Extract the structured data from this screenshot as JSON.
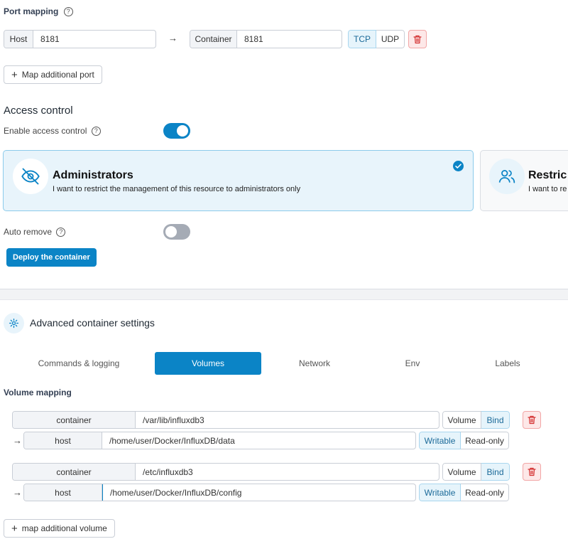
{
  "port_mapping": {
    "title": "Port mapping",
    "help": "?",
    "host_label": "Host",
    "host_value": "8181",
    "arrow": "→",
    "container_label": "Container",
    "container_value": "8181",
    "protocols": [
      "TCP",
      "UDP"
    ],
    "active_protocol": "TCP",
    "add_label": "Map additional port"
  },
  "access_control": {
    "title": "Access control",
    "enable_label": "Enable access control",
    "enabled": true,
    "options": [
      {
        "title": "Administrators",
        "description": "I want to restrict the management of this resource to administrators only",
        "selected": true,
        "icon": "eye-off-icon"
      },
      {
        "title": "Restric",
        "description": "I want to re",
        "selected": false,
        "icon": "users-icon"
      }
    ],
    "auto_remove_label": "Auto remove",
    "auto_remove": false,
    "deploy_label": "Deploy the container"
  },
  "advanced": {
    "title": "Advanced container settings",
    "tabs": [
      "Commands & logging",
      "Volumes",
      "Network",
      "Env",
      "Labels"
    ],
    "active_tab": "Volumes"
  },
  "volumes": {
    "title": "Volume mapping",
    "container_label": "container",
    "host_label": "host",
    "type_options": [
      "Volume",
      "Bind"
    ],
    "mode_options": [
      "Writable",
      "Read-only"
    ],
    "items": [
      {
        "container_path": "/var/lib/influxdb3",
        "host_path": "/home/user/Docker/InfluxDB/data",
        "type": "Bind",
        "mode": "Writable"
      },
      {
        "container_path": "/etc/influxdb3",
        "host_path": "/home/user/Docker/InfluxDB/config",
        "type": "Bind",
        "mode": "Writable"
      }
    ],
    "add_label": "map additional volume"
  },
  "colors": {
    "accent": "#0b84c6",
    "selected_card_bg": "#e8f4fb",
    "danger": "#d32f2f",
    "toggle_off": "#a5abb5"
  }
}
